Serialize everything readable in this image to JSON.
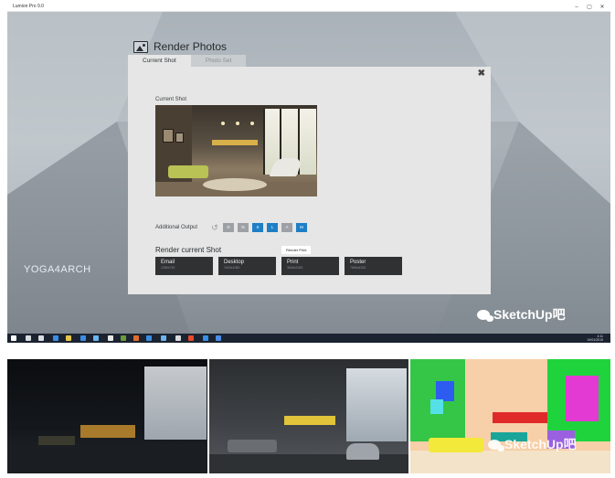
{
  "window": {
    "app_title": "Lumion Pro 9.0",
    "controls": [
      "–",
      "▢",
      "✕"
    ]
  },
  "backdrop": {
    "brand_text": "YOGA4ARCH"
  },
  "dialog": {
    "title": "Render Photos",
    "tabs": [
      {
        "label": "Current Shot",
        "active": true
      },
      {
        "label": "Photo Set",
        "active": false
      }
    ],
    "close_glyph": "✖",
    "current_shot_label": "Current Shot",
    "additional_output": {
      "label": "Additional Output",
      "reset_glyph": "↺",
      "buttons": [
        {
          "label": "D",
          "state": "grey"
        },
        {
          "label": "N",
          "state": "grey"
        },
        {
          "label": "S",
          "state": "blue"
        },
        {
          "label": "L",
          "state": "blue"
        },
        {
          "label": "A",
          "state": "grey"
        },
        {
          "label": "M",
          "state": "blue"
        }
      ]
    },
    "render_current_shot": {
      "title": "Render current Shot",
      "tooltip": "Render Print",
      "buttons": [
        {
          "name": "Email",
          "size": "1280x720"
        },
        {
          "name": "Desktop",
          "size": "1920x1080"
        },
        {
          "name": "Print",
          "size": "3840x2160"
        },
        {
          "name": "Poster",
          "size": "7680x4320"
        }
      ]
    }
  },
  "taskbar": {
    "clock_time": "4:11",
    "clock_date": "19/01/2019",
    "icon_colors": [
      "#ffffff",
      "#d9dde2",
      "#d9dde2",
      "#3a8ee6",
      "#e8c64a",
      "#3a8ee6",
      "#6bb5f0",
      "#e8e8e8",
      "#6a9c3a",
      "#e26d2a",
      "#3a8ee6",
      "#6bb5f0",
      "#d9dde2",
      "#e84a2a",
      "#3a8ee6",
      "#4a8ee6"
    ]
  },
  "watermark": {
    "text": "SketchUp吧"
  },
  "colors": {
    "accent_blue": "#1e7fc6",
    "button_dark": "#2f3133",
    "panel_bg": "#e6e6e6"
  }
}
